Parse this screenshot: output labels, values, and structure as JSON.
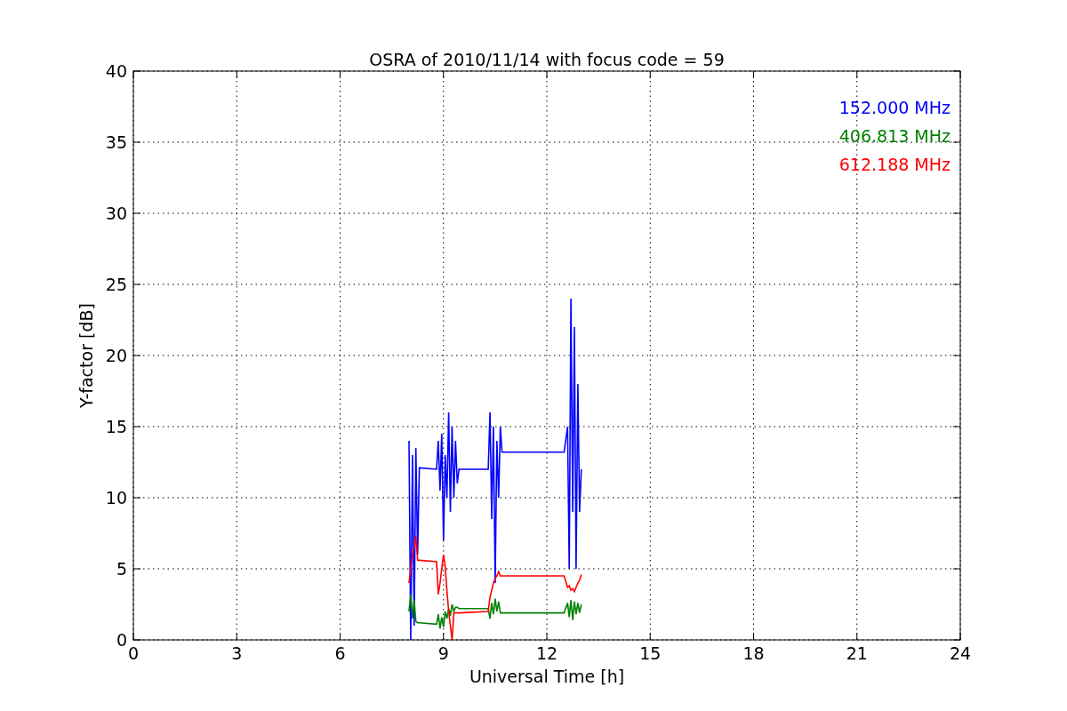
{
  "chart_data": {
    "type": "line",
    "grid": true,
    "title": "OSRA of 2010/11/14 with focus code = 59",
    "xlabel": "Universal Time [h]",
    "ylabel": "Y-factor [dB]",
    "x": [
      8.0,
      8.05,
      8.1,
      8.15,
      8.2,
      8.25,
      8.3,
      8.8,
      8.85,
      8.9,
      8.95,
      9.0,
      9.05,
      9.1,
      9.15,
      9.2,
      9.25,
      9.3,
      9.35,
      9.4,
      9.45,
      10.3,
      10.35,
      10.4,
      10.45,
      10.5,
      10.55,
      10.6,
      10.65,
      10.7,
      12.5,
      12.6,
      12.65,
      12.7,
      12.75,
      12.8,
      12.85,
      12.9,
      12.95,
      13.0
    ],
    "series": [
      {
        "name": "152.000 MHz",
        "color": "#0000ff",
        "values": [
          14,
          0,
          13,
          1,
          13.5,
          6,
          12.1,
          12,
          14,
          10.5,
          14.5,
          7,
          13,
          10,
          16,
          9,
          15,
          10,
          14,
          11,
          12,
          12,
          16,
          8.5,
          15,
          4,
          14,
          10,
          15,
          13.2,
          13.2,
          15,
          5,
          24,
          9,
          22,
          5,
          18,
          9,
          12
        ]
      },
      {
        "name": "406.813 MHz",
        "color": "#008000",
        "values": [
          2,
          3.2,
          1.5,
          2.8,
          1.3,
          1.2,
          1.2,
          1.1,
          1.8,
          0.8,
          1.6,
          0.9,
          2.0,
          1.5,
          2.2,
          1.7,
          2.5,
          2.0,
          2.3,
          2.3,
          2.2,
          2.2,
          1.5,
          2.6,
          1.8,
          2.9,
          2.0,
          2.7,
          1.9,
          1.9,
          1.9,
          2.6,
          1.6,
          2.8,
          1.4,
          2.7,
          1.8,
          2.6,
          1.9,
          2.5
        ]
      },
      {
        "name": "612.188 MHz",
        "color": "#ff0000",
        "values": [
          4,
          5,
          6,
          6.5,
          7.3,
          5.6,
          5.6,
          5.5,
          3.2,
          4,
          5,
          6,
          5.2,
          3.5,
          2,
          1,
          0,
          1.9,
          1.9,
          1.9,
          1.9,
          2,
          3,
          3.5,
          4,
          4.3,
          4.5,
          4.8,
          4.5,
          4.5,
          4.5,
          3.7,
          3.8,
          3.5,
          3.6,
          3.4,
          3.7,
          4,
          4.2,
          4.6
        ]
      }
    ],
    "xlim": [
      0,
      24
    ],
    "ylim": [
      0,
      40
    ],
    "xticks": [
      0,
      3,
      6,
      9,
      12,
      15,
      18,
      21,
      24
    ],
    "yticks": [
      0,
      5,
      10,
      15,
      20,
      25,
      30,
      35,
      40
    ]
  }
}
